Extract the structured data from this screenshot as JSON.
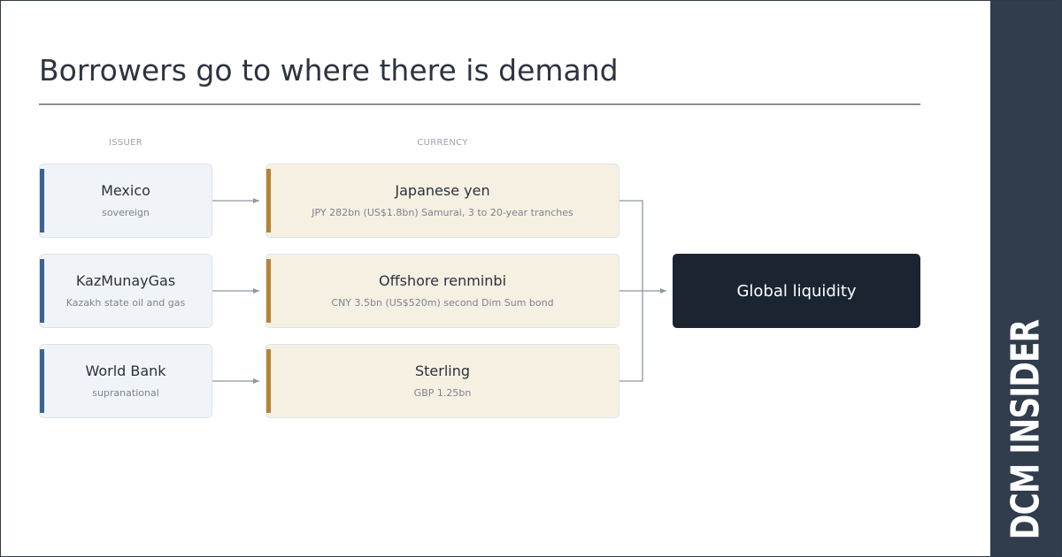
{
  "title": "Borrowers go to where there is demand",
  "columns": {
    "issuer": "ISSUER",
    "currency": "CURRENCY"
  },
  "issuers": [
    {
      "name": "Mexico",
      "sub": "sovereign"
    },
    {
      "name": "KazMunayGas",
      "sub": "Kazakh state oil and gas"
    },
    {
      "name": "World Bank",
      "sub": "supranational"
    }
  ],
  "currencies": [
    {
      "name": "Japanese yen",
      "sub": "JPY 282bn (US$1.8bn) Samurai, 3 to 20-year tranches"
    },
    {
      "name": "Offshore renminbi",
      "sub": "CNY 3.5bn (US$520m) second Dim Sum bond"
    },
    {
      "name": "Sterling",
      "sub": "GBP 1.25bn"
    }
  ],
  "target": "Global liquidity",
  "brand": "DCM INSIDER",
  "colors": {
    "issuer_accent": "#3a6493",
    "currency_accent": "#b58334",
    "target_bg": "#1b2431",
    "sidebar_bg": "#313c4c"
  }
}
